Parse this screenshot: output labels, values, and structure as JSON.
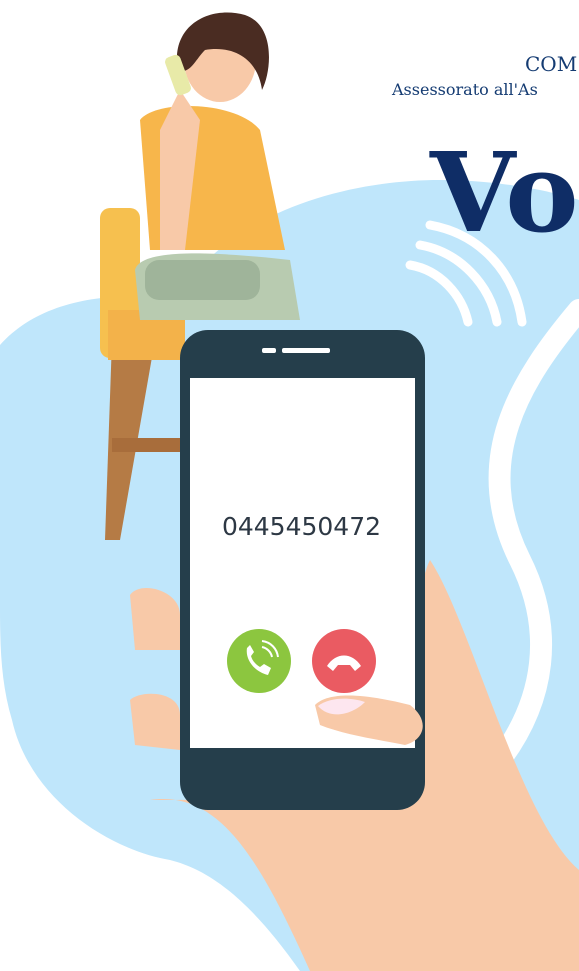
{
  "header": {
    "org_line": "COM",
    "dept_line": "Assessorato all'As",
    "headline": "Vo"
  },
  "call": {
    "number": "0445450472",
    "accept_icon": "phone-accept-icon",
    "decline_icon": "phone-decline-icon"
  },
  "colors": {
    "blob": "#bfe6fb",
    "phone_frame": "#253e4b",
    "accept": "#8cc63f",
    "decline": "#ea5b62",
    "shirt": "#f7b64b",
    "skin": "#f8c9a8",
    "headline": "#0f2d66"
  }
}
